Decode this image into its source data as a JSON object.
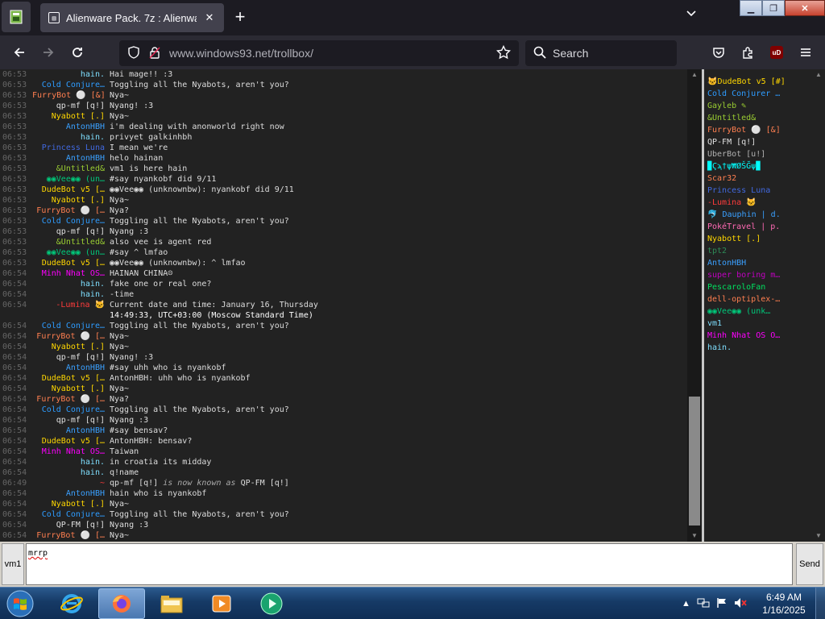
{
  "browser": {
    "tab_title": "Alienware Pack. 7z : Alienware :",
    "url_host": "www.windows93.net",
    "url_path": "/trollbox/",
    "search_placeholder": "Search",
    "ublock_label": "uD"
  },
  "chat": {
    "messages": [
      {
        "time": "06:53",
        "nick": "hain.",
        "color": "#7fdfff",
        "text": "Hai mage!! :3",
        "style": ""
      },
      {
        "time": "06:53",
        "nick": "Cold Conjure…",
        "color": "#2e9cff",
        "text": "Toggling all the Nyabots, aren't you?",
        "style": ""
      },
      {
        "time": "06:53",
        "nick": "FurryBot ⚪ [&]",
        "color": "#ff7f50",
        "text": "Nya~",
        "style": ""
      },
      {
        "time": "06:53",
        "nick": "qp-mf [q!]",
        "color": "#e0e0e0",
        "text": "Nyang! :3",
        "style": ""
      },
      {
        "time": "06:53",
        "nick": "Nyabott [.]",
        "color": "#ffd700",
        "text": "Nya~",
        "style": ""
      },
      {
        "time": "06:53",
        "nick": "AntonHBH",
        "color": "#3aa0ff",
        "text": "i'm dealing with anonworld right now",
        "style": ""
      },
      {
        "time": "06:53",
        "nick": "hain.",
        "color": "#7fdfff",
        "text": "privyet galkinhbh",
        "style": ""
      },
      {
        "time": "06:53",
        "nick": "Princess Luna",
        "color": "#4169e1",
        "text": "I mean we're",
        "style": ""
      },
      {
        "time": "06:53",
        "nick": "AntonHBH",
        "color": "#3aa0ff",
        "text": "helo hainan",
        "style": ""
      },
      {
        "time": "06:53",
        "nick": "&Untitled&",
        "color": "#9acd32",
        "text": "vm1 is here hain",
        "style": ""
      },
      {
        "time": "06:53",
        "nick": "◉◉Vee◉◉ (un…",
        "color": "#00c87a",
        "text": "#say nyankobf did 9/11",
        "style": ""
      },
      {
        "time": "06:53",
        "nick": "DudeBot v5 […",
        "color": "#ffd700",
        "text": "◉◉Vee◉◉ (unknownbw): nyankobf did 9/11",
        "style": ""
      },
      {
        "time": "06:53",
        "nick": "Nyabott [.]",
        "color": "#ffd700",
        "text": "Nya~",
        "style": ""
      },
      {
        "time": "06:53",
        "nick": "FurryBot ⚪ […",
        "color": "#ff7f50",
        "text": "Nya?",
        "style": ""
      },
      {
        "time": "06:53",
        "nick": "Cold Conjure…",
        "color": "#2e9cff",
        "text": "Toggling all the Nyabots, aren't you?",
        "style": ""
      },
      {
        "time": "06:53",
        "nick": "qp-mf [q!]",
        "color": "#e0e0e0",
        "text": "Nyang :3",
        "style": ""
      },
      {
        "time": "06:53",
        "nick": "&Untitled&",
        "color": "#9acd32",
        "text": "also vee is agent red",
        "style": ""
      },
      {
        "time": "06:53",
        "nick": "◉◉Vee◉◉ (un…",
        "color": "#00c87a",
        "text": "#say ^ lmfao",
        "style": ""
      },
      {
        "time": "06:53",
        "nick": "DudeBot v5 […",
        "color": "#ffd700",
        "text": "◉◉Vee◉◉ (unknownbw): ^ lmfao",
        "style": ""
      },
      {
        "time": "06:54",
        "nick": "Minh Nhat OS…",
        "color": "#ff00ff",
        "text": "HAINAN CHINA☹",
        "style": ""
      },
      {
        "time": "06:54",
        "nick": "hain.",
        "color": "#7fdfff",
        "text": "fake one or real one?",
        "style": ""
      },
      {
        "time": "06:54",
        "nick": "hain.",
        "color": "#7fdfff",
        "text": "-time",
        "style": ""
      },
      {
        "time": "06:54",
        "nick": "-Lumina 🐱",
        "color": "#ff3b3b",
        "text": "Current date and time: January 16, Thursday",
        "style": ""
      },
      {
        "time": "",
        "nick": "",
        "color": "#ffffff",
        "text": "14:49:33, UTC+03:00 (Moscow Standard Time)",
        "style": ""
      },
      {
        "time": "06:54",
        "nick": "Cold Conjure…",
        "color": "#2e9cff",
        "text": "Toggling all the Nyabots, aren't you?",
        "style": ""
      },
      {
        "time": "06:54",
        "nick": "FurryBot ⚪ […",
        "color": "#ff7f50",
        "text": "Nya~",
        "style": ""
      },
      {
        "time": "06:54",
        "nick": "Nyabott [.]",
        "color": "#ffd700",
        "text": "Nya~",
        "style": ""
      },
      {
        "time": "06:54",
        "nick": "qp-mf [q!]",
        "color": "#e0e0e0",
        "text": "Nyang! :3",
        "style": ""
      },
      {
        "time": "06:54",
        "nick": "AntonHBH",
        "color": "#3aa0ff",
        "text": "#say uhh who is nyankobf",
        "style": ""
      },
      {
        "time": "06:54",
        "nick": "DudeBot v5 […",
        "color": "#ffd700",
        "text": "AntonHBH: uhh who is nyankobf",
        "style": ""
      },
      {
        "time": "06:54",
        "nick": "Nyabott [.]",
        "color": "#ffd700",
        "text": "Nya~",
        "style": ""
      },
      {
        "time": "06:54",
        "nick": "FurryBot ⚪ […",
        "color": "#ff7f50",
        "text": "Nya?",
        "style": ""
      },
      {
        "time": "06:54",
        "nick": "Cold Conjure…",
        "color": "#2e9cff",
        "text": "Toggling all the Nyabots, aren't you?",
        "style": ""
      },
      {
        "time": "06:54",
        "nick": "qp-mf [q!]",
        "color": "#e0e0e0",
        "text": "Nyang :3",
        "style": ""
      },
      {
        "time": "06:54",
        "nick": "AntonHBH",
        "color": "#3aa0ff",
        "text": "#say bensav?",
        "style": ""
      },
      {
        "time": "06:54",
        "nick": "DudeBot v5 […",
        "color": "#ffd700",
        "text": "AntonHBH: bensav?",
        "style": ""
      },
      {
        "time": "06:54",
        "nick": "Minh Nhat OS…",
        "color": "#ff00ff",
        "text": "Taiwan",
        "style": ""
      },
      {
        "time": "06:54",
        "nick": "hain.",
        "color": "#7fdfff",
        "text": "in croatia its midday",
        "style": ""
      },
      {
        "time": "06:54",
        "nick": "hain.",
        "color": "#7fdfff",
        "text": "q!name",
        "style": ""
      },
      {
        "time": "06:49",
        "nick": "~",
        "color": "#ff3b3b",
        "text": "qp-mf [q!] <i>is now known as</i> QP-FM [q!]",
        "style": "html"
      },
      {
        "time": "06:54",
        "nick": "AntonHBH",
        "color": "#3aa0ff",
        "text": "hain who is nyankobf",
        "style": ""
      },
      {
        "time": "06:54",
        "nick": "Nyabott [.]",
        "color": "#ffd700",
        "text": "Nya~",
        "style": ""
      },
      {
        "time": "06:54",
        "nick": "Cold Conjure…",
        "color": "#2e9cff",
        "text": "Toggling all the Nyabots, aren't you?",
        "style": ""
      },
      {
        "time": "06:54",
        "nick": "QP-FM [q!]",
        "color": "#e0e0e0",
        "text": "Nyang :3",
        "style": ""
      },
      {
        "time": "06:54",
        "nick": "FurryBot ⚪ […",
        "color": "#ff7f50",
        "text": "Nya~",
        "style": ""
      }
    ]
  },
  "users": [
    {
      "name": "🐱DudeBot v5 [#]",
      "color": "#ffd700"
    },
    {
      "name": "Cold Conjurer …",
      "color": "#2e9cff"
    },
    {
      "name": "Gayleb ✎",
      "color": "#9acd32"
    },
    {
      "name": "&Untitled&",
      "color": "#9acd32"
    },
    {
      "name": "FurryBot ⚪ [&]",
      "color": "#ff7f50"
    },
    {
      "name": "QP-FM [q!]",
      "color": "#e0e0e0"
    },
    {
      "name": "UberBot [u!]",
      "color": "#b0b0b0"
    },
    {
      "name": "▉Ϛϡ†ψ₩ØŠĞψ▉",
      "color": "#00ffff"
    },
    {
      "name": "Scar32",
      "color": "#ff7f50"
    },
    {
      "name": "Princess Luna",
      "color": "#4169e1"
    },
    {
      "name": "-Lumina 🐱",
      "color": "#ff3b3b"
    },
    {
      "name": "🐬 Dauphin | d.",
      "color": "#3aa0ff"
    },
    {
      "name": "PokéTravel | p.",
      "color": "#ff69b4"
    },
    {
      "name": "Nyabott [.]",
      "color": "#ffd700"
    },
    {
      "name": "tpt2",
      "color": "#2e8b57"
    },
    {
      "name": "AntonHBH",
      "color": "#3aa0ff"
    },
    {
      "name": "super boring m…",
      "color": "#c000c0"
    },
    {
      "name": "PescaroloFan",
      "color": "#00e060"
    },
    {
      "name": "dell-optiplex-…",
      "color": "#ff7f50"
    },
    {
      "name": "◉◉Vee◉◉ (unk…",
      "color": "#00c87a"
    },
    {
      "name": "vm1",
      "color": "#7fdfff"
    },
    {
      "name": "Minh Nhat OS O…",
      "color": "#ff00ff"
    },
    {
      "name": "hain.",
      "color": "#7fdfff"
    }
  ],
  "input": {
    "nick_label": "vm1",
    "value": "mrrp",
    "send_label": "Send"
  },
  "taskbar": {
    "time": "6:49 AM",
    "date": "1/16/2025"
  }
}
